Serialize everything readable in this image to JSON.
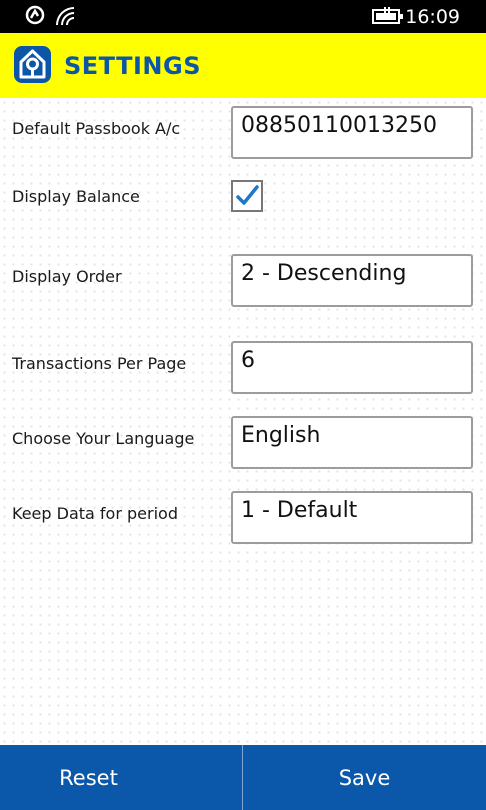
{
  "status_bar": {
    "time": "16:09",
    "icons": [
      "nfc-icon",
      "wifi-icon",
      "battery-charging-icon"
    ]
  },
  "header": {
    "title": "SETTINGS",
    "logo": "bank-logo-icon",
    "accent_color": "#ffff00",
    "title_color": "#0c56a8"
  },
  "settings": {
    "passbook_label": "Default Passbook A/c",
    "passbook_value": "08850110013250",
    "balance_label": "Display Balance",
    "balance_checked": true,
    "order_label": "Display Order",
    "order_value": "2 - Descending",
    "per_page_label": "Transactions Per Page",
    "per_page_value": "6",
    "language_label": "Choose Your Language",
    "language_value": "English",
    "keep_data_label": "Keep Data for period",
    "keep_data_value": "1 - Default"
  },
  "footer": {
    "reset_label": "Reset",
    "save_label": "Save",
    "bar_color": "#0b58ab"
  }
}
